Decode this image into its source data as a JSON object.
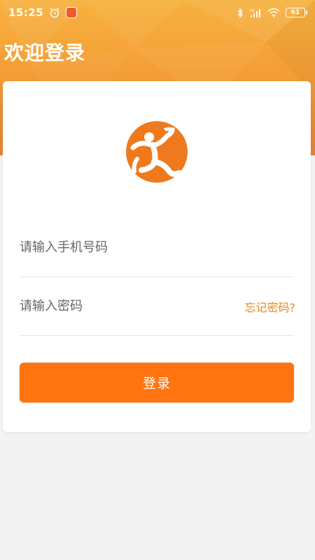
{
  "status_bar": {
    "time": "15:25",
    "battery_level": "61",
    "icons": [
      "alarm-icon",
      "app-notification-icon",
      "bluetooth-icon",
      "hd-signal-icon",
      "wifi-icon",
      "battery-icon"
    ]
  },
  "header": {
    "title": "欢迎登录"
  },
  "login_form": {
    "logo": "running-courier-logo",
    "phone_placeholder": "请输入手机号码",
    "phone_value": "",
    "password_placeholder": "请输入密码",
    "password_value": "",
    "forgot_password_label": "忘记密码?",
    "submit_label": "登录"
  },
  "colors": {
    "header_gradient_top": "#f6b23f",
    "header_gradient_bottom": "#ef8431",
    "primary": "#ff7410",
    "link": "#e08a24",
    "background": "#f3f3f3",
    "card": "#ffffff"
  }
}
